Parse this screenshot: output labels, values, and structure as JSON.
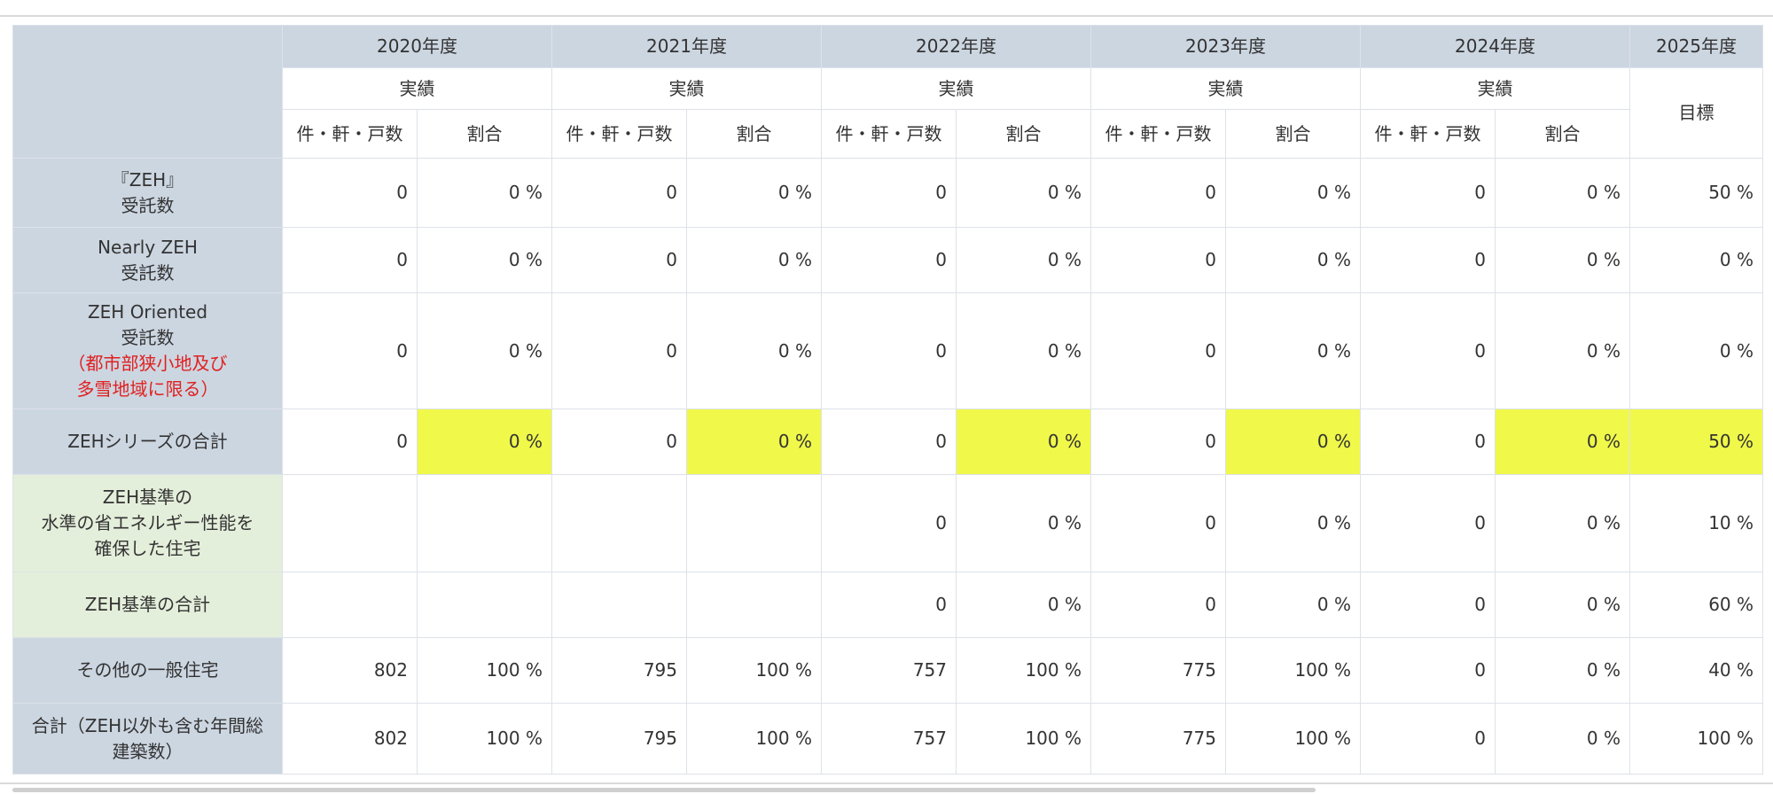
{
  "table": {
    "years": [
      "2020年度",
      "2021年度",
      "2022年度",
      "2023年度",
      "2024年度",
      "2025年度"
    ],
    "actual_label": "実績",
    "count_label": "件・軒・戸数",
    "ratio_label": "割合",
    "target_label": "目標",
    "rows": [
      {
        "label_lines": [
          "『ZEH』",
          "受託数"
        ],
        "cells": [
          "0",
          "0 %",
          "0",
          "0 %",
          "0",
          "0 %",
          "0",
          "0 %",
          "0",
          "0 %"
        ],
        "target": "50 %"
      },
      {
        "label_lines": [
          "Nearly ZEH",
          "受託数"
        ],
        "cells": [
          "0",
          "0 %",
          "0",
          "0 %",
          "0",
          "0 %",
          "0",
          "0 %",
          "0",
          "0 %"
        ],
        "target": "0 %"
      },
      {
        "label_lines": [
          "ZEH Oriented",
          "受託数"
        ],
        "note_lines": [
          "（都市部狭小地及び",
          "多雪地域に限る）"
        ],
        "cells": [
          "0",
          "0 %",
          "0",
          "0 %",
          "0",
          "0 %",
          "0",
          "0 %",
          "0",
          "0 %"
        ],
        "target": "0 %"
      },
      {
        "label_lines": [
          "ZEHシリーズの合計"
        ],
        "cells": [
          "0",
          "0 %",
          "0",
          "0 %",
          "0",
          "0 %",
          "0",
          "0 %",
          "0",
          "0 %"
        ],
        "target": "50 %"
      },
      {
        "label_lines": [
          "ZEH基準の",
          "水準の省エネルギー性能を",
          "確保した住宅"
        ],
        "cells": [
          "",
          "",
          "",
          "",
          "0",
          "0 %",
          "0",
          "0 %",
          "0",
          "0 %"
        ],
        "target": "10 %"
      },
      {
        "label_lines": [
          "ZEH基準の合計"
        ],
        "cells": [
          "",
          "",
          "",
          "",
          "0",
          "0 %",
          "0",
          "0 %",
          "0",
          "0 %"
        ],
        "target": "60 %"
      },
      {
        "label_lines": [
          "その他の一般住宅"
        ],
        "cells": [
          "802",
          "100 %",
          "795",
          "100 %",
          "757",
          "100 %",
          "775",
          "100 %",
          "0",
          "0 %"
        ],
        "target": "40 %"
      },
      {
        "label_lines": [
          "合計（ZEH以外も含む年間総",
          "建築数）"
        ],
        "cells": [
          "802",
          "100 %",
          "795",
          "100 %",
          "757",
          "100 %",
          "775",
          "100 %",
          "0",
          "0 %"
        ],
        "target": "100 %"
      }
    ]
  },
  "colors": {
    "header_bg": "#ccd6e1",
    "label_green_bg": "#e4efdb",
    "highlight_yellow": "#f0f84a",
    "note_red": "#e02020"
  }
}
